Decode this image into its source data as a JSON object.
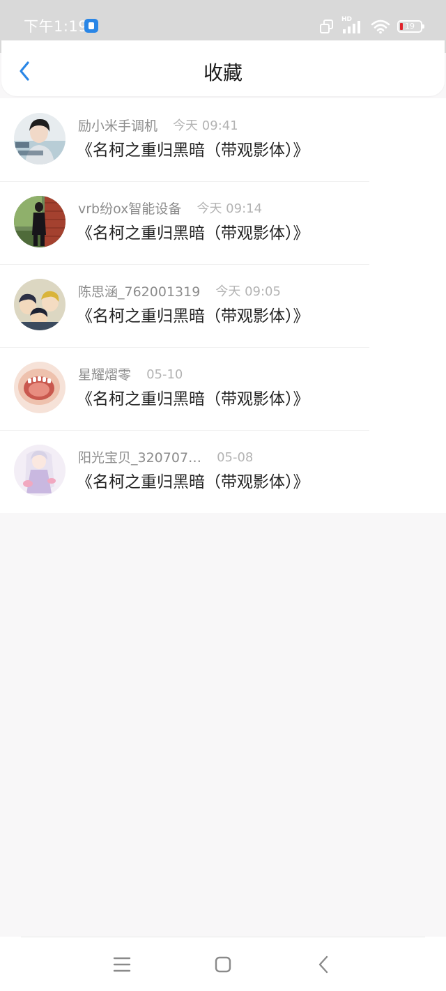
{
  "status_bar": {
    "time": "下午1:19",
    "network": "HD",
    "battery_level": "19",
    "battery_color": "#e0222a"
  },
  "header": {
    "title": "收藏",
    "back_icon": "chevron-left-icon",
    "accent_color": "#2a86e6"
  },
  "favorites": [
    {
      "author": "励小米手调机",
      "time": "今天 09:41",
      "title": "《名柯之重归黑暗（带观影体）》",
      "avatar": "boy-portrait-avatar"
    },
    {
      "author": "vrb纷ox智能设备",
      "time": "今天 09:14",
      "title": "《名柯之重归黑暗（带观影体）》",
      "avatar": "figure-by-brick-wall-avatar"
    },
    {
      "author": "陈思涵_762001319",
      "time": "今天 09:05",
      "title": "《名柯之重归黑暗（带观影体）》",
      "avatar": "anime-group-avatar"
    },
    {
      "author": "星耀熠零",
      "time": "05-10",
      "title": "《名柯之重归黑暗（带观影体）》",
      "avatar": "pink-illustration-avatar"
    },
    {
      "author": "阳光宝贝_320707…",
      "time": "05-08",
      "title": "《名柯之重归黑暗（带观影体）》",
      "avatar": "anime-girl-avatar"
    }
  ],
  "nav_bar": {
    "menu_icon": "menu-icon",
    "home_icon": "home-square-icon",
    "back_icon": "back-triangle-icon"
  }
}
